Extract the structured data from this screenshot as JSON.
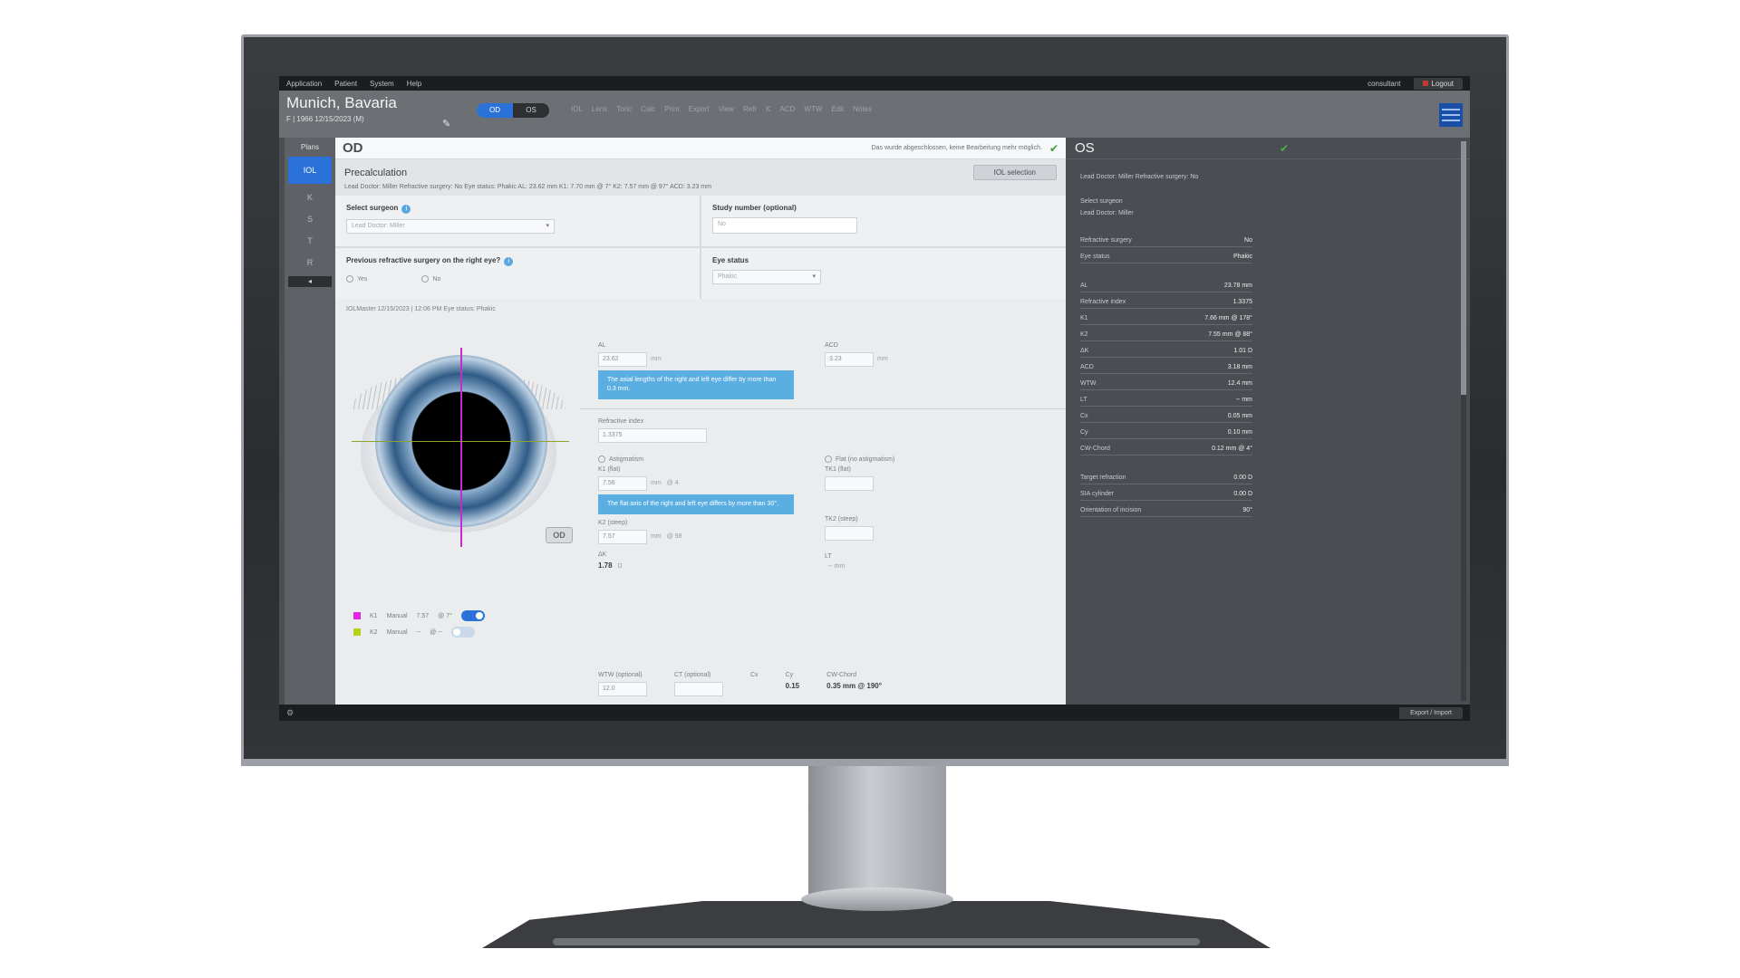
{
  "topbar": {
    "menu": [
      "Application",
      "Patient",
      "System",
      "Help"
    ],
    "user": "consultant",
    "logout": "Logout"
  },
  "header": {
    "patient_name": "Munich, Bavaria",
    "patient_sub": "F | 1966    12/15/2023  (M)",
    "eye_od": "OD",
    "eye_os": "OS",
    "tools": [
      "IOL",
      "Lens",
      "Toric",
      "Calc",
      "Print",
      "Export",
      "View",
      "Refr",
      "K",
      "ACD",
      "WTW",
      "Edit",
      "Notes"
    ]
  },
  "sidebar": {
    "title": "Plans",
    "items": [
      "IOL",
      "K",
      "S",
      "T",
      "R",
      "◂"
    ]
  },
  "main": {
    "eye_label": "OD",
    "status_message": "Das wurde abgeschlossen, keine Bearbeitung mehr möglich.",
    "precalc": {
      "title": "Precalculation",
      "info": "Lead Doctor: Miller   Refractive surgery: No   Eye status: Phakic   AL: 23.62 mm   K1: 7.70 mm @ 7°   K2: 7.57 mm @ 97°   ACD: 3.23 mm",
      "lens_button": "IOL selection"
    },
    "surgeon": {
      "label": "Select surgeon",
      "value": "Lead Doctor: Miller"
    },
    "study": {
      "label": "Study number",
      "optional": "(optional)",
      "value": "No"
    },
    "prev_surgery": {
      "label": "Previous refractive surgery on the right eye?",
      "yes": "Yes",
      "no": "No"
    },
    "eye_status": {
      "label": "Eye status",
      "value": "Phakic"
    },
    "device_line": "IOLMaster   12/15/2023 | 12:06 PM   Eye status: Phakic",
    "legend": [
      {
        "name": "K1",
        "mode": "Manual",
        "value": "7.57",
        "axis": "@ 7°"
      },
      {
        "name": "K2",
        "mode": "Manual",
        "value": "--",
        "axis": "@ --"
      }
    ],
    "od_stamp": "OD",
    "fields": {
      "al_label": "AL",
      "al_value": "23.62",
      "al_unit": "mm",
      "acd_label": "ACD",
      "acd_value": "3.23",
      "acd_unit": "mm",
      "alert_al": "The axial lengths of the right and left eye differ by more than 0.3 mm.",
      "ri_label": "Refractive index",
      "ri_value": "1.3375",
      "astig_label": "Astigmatism",
      "flat_label": "Flat (no astigmatism)",
      "k1_label": "K1 (flat)",
      "k1_value": "7.56",
      "k1_unit": "mm",
      "k1_axis": "@ 4",
      "k2_label": "K2 (steep)",
      "k2_value": "7.57",
      "k2_unit": "mm",
      "k2_axis": "@ 98",
      "tk1_label": "TK1 (flat)",
      "tk2_label": "TK2 (steep)",
      "alert_k": "The flat axis of the right and left eye differs by more than 30°.",
      "cyl_label": "ΔK",
      "cyl_value": "1.78",
      "cyl_unit": "D",
      "lt_label": "LT",
      "lt_value": "-- mm"
    },
    "bottom": {
      "wtw_label": "WTW (optional)",
      "wtw_value": "12.0",
      "cct_label": "CT (optional)",
      "cx_label": "Cx",
      "cy_label": "Cy",
      "ix_label": "CW-Chord",
      "cy_value": "0.15",
      "chord_value": "0.35 mm @ 190°"
    }
  },
  "right": {
    "eye_label": "OS",
    "header_info": "Lead Doctor: Miller   Refractive surgery: No",
    "surgeon_label": "Select surgeon",
    "surgeon_value": "Lead Doctor: Miller",
    "group1": [
      {
        "label": "Refractive surgery",
        "value": "No"
      },
      {
        "label": "Eye status",
        "value": "Phakic"
      }
    ],
    "group2": [
      {
        "label": "AL",
        "value": "23.78 mm"
      },
      {
        "label": "Refractive index",
        "value": "1.3375"
      },
      {
        "label": "K1",
        "value": "7.66 mm @ 178°"
      },
      {
        "label": "K2",
        "value": "7.55 mm @ 88°"
      },
      {
        "label": "ΔK",
        "value": "1.01 D"
      },
      {
        "label": "ACD",
        "value": "3.18 mm"
      },
      {
        "label": "WTW",
        "value": "12.4 mm"
      },
      {
        "label": "LT",
        "value": "-- mm"
      },
      {
        "label": "Cx",
        "value": "0.05 mm"
      },
      {
        "label": "Cy",
        "value": "0.10 mm"
      },
      {
        "label": "CW-Chord",
        "value": "0.12 mm @ 4°"
      }
    ],
    "group3": [
      {
        "label": "Target refraction",
        "value": "0.00 D"
      },
      {
        "label": "SIA cylinder",
        "value": "0.00 D"
      },
      {
        "label": "Orientation of incision",
        "value": "90°"
      }
    ]
  },
  "statusbar": {
    "export": "Export / Import"
  }
}
